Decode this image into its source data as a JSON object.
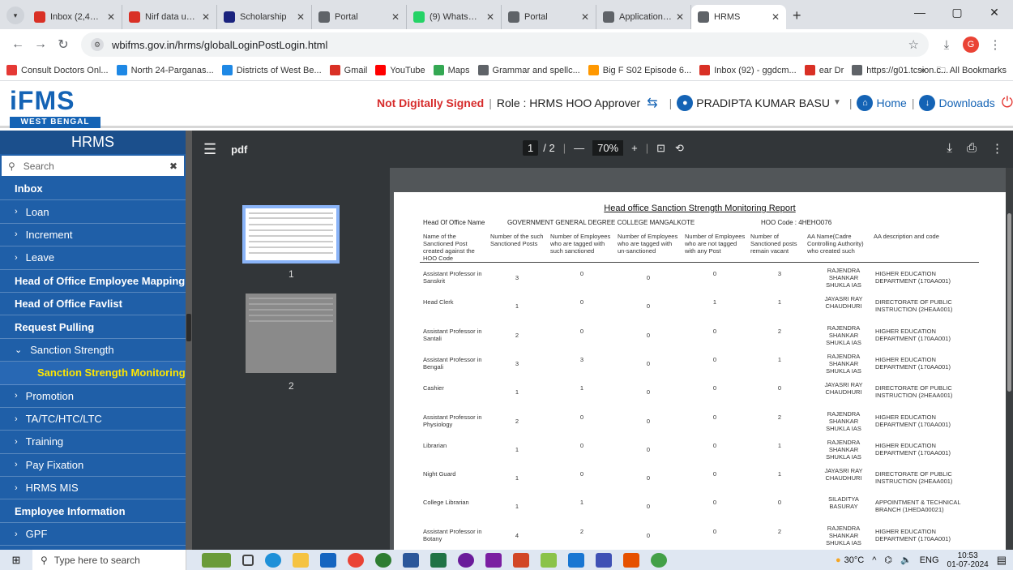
{
  "browser": {
    "tabs": [
      {
        "title": "Inbox (2,459) - g",
        "color": "#d93025"
      },
      {
        "title": "Nirf data upload",
        "color": "#d93025"
      },
      {
        "title": "Scholarship",
        "color": "#1a237e"
      },
      {
        "title": "Portal",
        "color": "#5f6368"
      },
      {
        "title": "(9) WhatsApp",
        "color": "#25d366"
      },
      {
        "title": "Portal",
        "color": "#5f6368"
      },
      {
        "title": "Application List",
        "color": "#5f6368"
      },
      {
        "title": "HRMS",
        "color": "#5f6368"
      }
    ],
    "url": "wbifms.gov.in/hrms/globalLoginPostLogin.html",
    "bookmarks": [
      {
        "label": "Consult Doctors Onl...",
        "color": "#e53935"
      },
      {
        "label": "North 24-Parganas...",
        "color": "#1e88e5"
      },
      {
        "label": "Districts of West Be...",
        "color": "#1e88e5"
      },
      {
        "label": "Gmail",
        "color": "#d93025"
      },
      {
        "label": "YouTube",
        "color": "#ff0000"
      },
      {
        "label": "Maps",
        "color": "#34a853"
      },
      {
        "label": "Grammar and spellc...",
        "color": "#5f6368"
      },
      {
        "label": "Big F S02 Episode 6...",
        "color": "#ff9800"
      },
      {
        "label": "Inbox (92) - ggdcm...",
        "color": "#d93025"
      },
      {
        "label": "ear Dr",
        "color": "#d93025"
      },
      {
        "label": "https://g01.tcsion.c...",
        "color": "#5f6368"
      }
    ],
    "bookmarks_more": "»",
    "all_bookmarks": "All Bookmarks"
  },
  "header": {
    "logo_text": "iFMS",
    "logo_sub": "WEST BENGAL",
    "not_signed": "Not Digitally Signed",
    "role": "Role : HRMS HOO Approver",
    "user": "PRADIPTA KUMAR BASU",
    "home": "Home",
    "downloads": "Downloads"
  },
  "sidebar": {
    "title": "HRMS",
    "search_placeholder": "Search",
    "items": [
      {
        "label": "Inbox",
        "kind": "top"
      },
      {
        "label": "Loan",
        "kind": "sub"
      },
      {
        "label": "Increment",
        "kind": "sub"
      },
      {
        "label": "Leave",
        "kind": "sub"
      },
      {
        "label": "Head of Office Employee Mapping",
        "kind": "top"
      },
      {
        "label": "Head of Office Favlist",
        "kind": "top"
      },
      {
        "label": "Request Pulling",
        "kind": "top"
      },
      {
        "label": "Sanction Strength",
        "kind": "open"
      },
      {
        "label": "Sanction Strength Monitoring",
        "kind": "child"
      },
      {
        "label": "Promotion",
        "kind": "sub"
      },
      {
        "label": "TA/TC/HTC/LTC",
        "kind": "sub"
      },
      {
        "label": "Training",
        "kind": "sub"
      },
      {
        "label": "Pay Fixation",
        "kind": "sub"
      },
      {
        "label": "HRMS MIS",
        "kind": "sub"
      },
      {
        "label": "Employee Information",
        "kind": "top"
      },
      {
        "label": "GPF",
        "kind": "sub"
      }
    ]
  },
  "pdf": {
    "name": "pdf",
    "page_current": "1",
    "page_total": "/ 2",
    "zoom": "70%",
    "thumb1_num": "1",
    "thumb2_num": "2"
  },
  "report": {
    "title": "Head office Sanction Strength Monitoring Report",
    "hoo_label": "Head Of Office Name",
    "hoo_name": "GOVERNMENT GENERAL DEGREE COLLEGE MANGALKOTE",
    "hoo_code": "HOO Code :  4HEHO076",
    "columns": [
      "Name of the Sanctioned Post created against the HOO Code",
      "Number of the such Sanctioned Posts",
      "Number of Employees who are tagged with such sanctioned",
      "Number of Employees who are tagged with un-sanctioned",
      "Number of Employees who are not tagged with any Post",
      "Number of Sanctioned posts remain vacant",
      "AA Name(Cadre Controlling Authority) who created such",
      "AA description and code"
    ],
    "rows": [
      {
        "post": "Assistant Professor in Sanskrit",
        "n1": "3",
        "n2": "0",
        "n3": "0",
        "n4": "0",
        "n5": "3",
        "aa": "RAJENDRA SHANKAR SHUKLA IAS",
        "desc": "HIGHER EDUCATION DEPARTMENT (170AA001)"
      },
      {
        "post": "Head Clerk",
        "n1": "1",
        "n2": "0",
        "n3": "0",
        "n4": "1",
        "n5": "1",
        "aa": "JAYASRI RAY CHAUDHURI",
        "desc": "DIRECTORATE OF PUBLIC INSTRUCTION (2HEAA001)"
      },
      {
        "post": "Assistant Professor in Santali",
        "n1": "2",
        "n2": "0",
        "n3": "0",
        "n4": "0",
        "n5": "2",
        "aa": "RAJENDRA SHANKAR SHUKLA IAS",
        "desc": "HIGHER EDUCATION DEPARTMENT (170AA001)"
      },
      {
        "post": "Assistant Professor in Bengali",
        "n1": "3",
        "n2": "3",
        "n3": "0",
        "n4": "0",
        "n5": "1",
        "aa": "RAJENDRA SHANKAR SHUKLA IAS",
        "desc": "HIGHER EDUCATION DEPARTMENT (170AA001)"
      },
      {
        "post": "Cashier",
        "n1": "1",
        "n2": "1",
        "n3": "0",
        "n4": "0",
        "n5": "0",
        "aa": "JAYASRI RAY CHAUDHURI",
        "desc": "DIRECTORATE OF PUBLIC INSTRUCTION (2HEAA001)"
      },
      {
        "post": "Assistant Professor in Physiology",
        "n1": "2",
        "n2": "0",
        "n3": "0",
        "n4": "0",
        "n5": "2",
        "aa": "RAJENDRA SHANKAR SHUKLA IAS",
        "desc": "HIGHER EDUCATION DEPARTMENT (170AA001)"
      },
      {
        "post": "Librarian",
        "n1": "1",
        "n2": "0",
        "n3": "0",
        "n4": "0",
        "n5": "1",
        "aa": "RAJENDRA SHANKAR SHUKLA IAS",
        "desc": "HIGHER EDUCATION DEPARTMENT (170AA001)"
      },
      {
        "post": "Night Guard",
        "n1": "1",
        "n2": "0",
        "n3": "0",
        "n4": "0",
        "n5": "1",
        "aa": "JAYASRI RAY CHAUDHURI",
        "desc": "DIRECTORATE OF PUBLIC INSTRUCTION (2HEAA001)"
      },
      {
        "post": "College Librarian",
        "n1": "1",
        "n2": "1",
        "n3": "0",
        "n4": "0",
        "n5": "0",
        "aa": "SILADITYA BASURAY",
        "desc": "APPOINTMENT & TECHNICAL BRANCH (1HEDA00021)"
      },
      {
        "post": "Assistant Professor in Botany",
        "n1": "4",
        "n2": "2",
        "n3": "0",
        "n4": "0",
        "n5": "2",
        "aa": "RAJENDRA SHANKAR SHUKLA IAS",
        "desc": "HIGHER EDUCATION DEPARTMENT (170AA001)"
      }
    ]
  },
  "taskbar": {
    "search_placeholder": "Type here to search",
    "temp": "30°C",
    "lang": "ENG",
    "time": "10:53",
    "date": "01-07-2024"
  }
}
